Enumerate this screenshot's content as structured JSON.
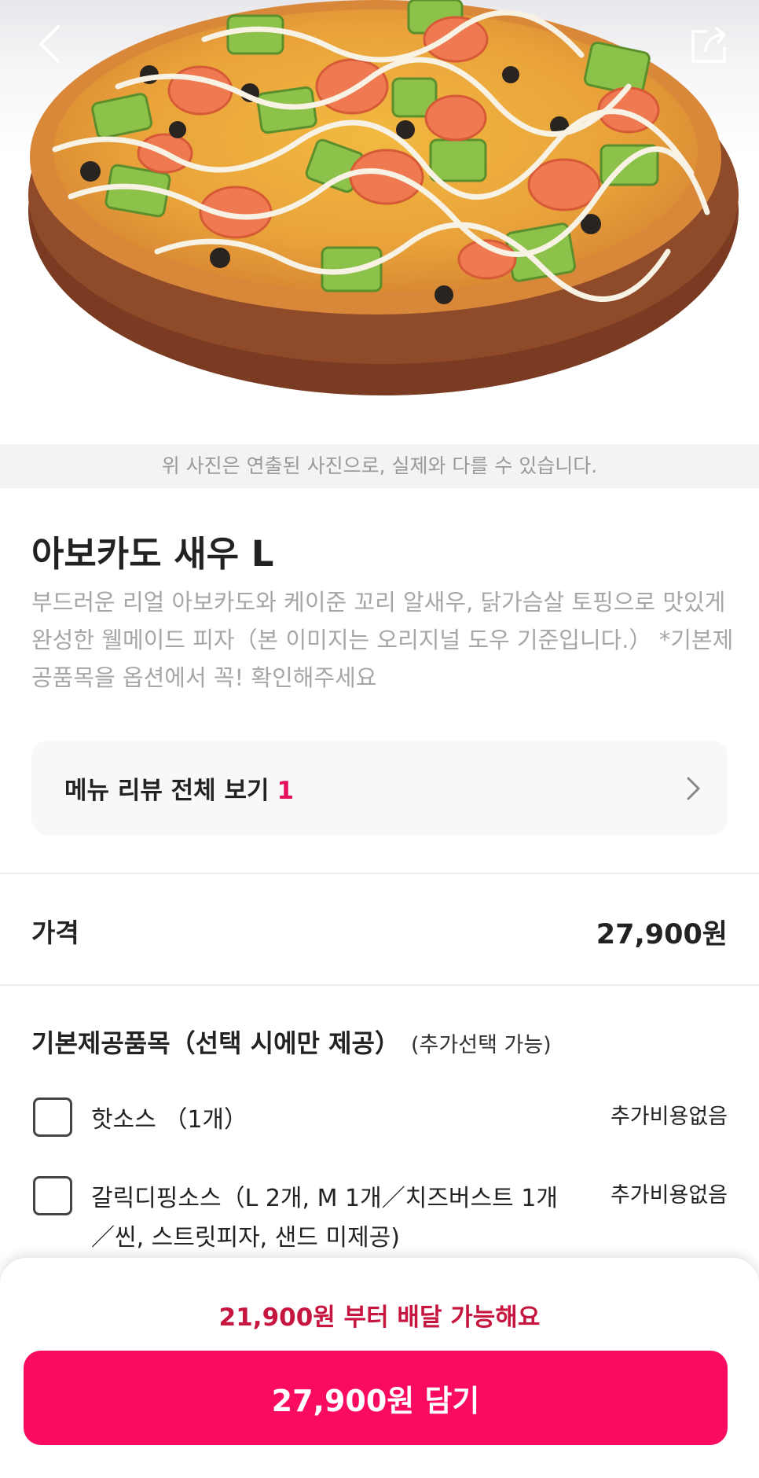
{
  "hero": {
    "image_alt": "Avocado shrimp pizza photo",
    "back_icon": "chevron-left-icon",
    "share_icon": "share-icon"
  },
  "disclaimer": "위 사진은 연출된 사진으로, 실제와 다를 수 있습니다.",
  "product": {
    "name": "아보카도 새우 L",
    "description": "부드러운 리얼 아보카도와 케이준 꼬리 알새우, 닭가슴살 토핑으로 맛있게 완성한 웰메이드 피자（본 이미지는 오리지널 도우 기준입니다.） *기본제공품목을 옵션에서 꼭! 확인해주세요"
  },
  "review": {
    "label": "메뉴 리뷰 전체 보기",
    "count": "1",
    "chevron_icon": "chevron-right-icon"
  },
  "price": {
    "label": "가격",
    "value": "27,900원"
  },
  "options_section": {
    "title": "기본제공품목（선택 시에만 제공）",
    "subtitle": "(추가선택 가능)",
    "items": [
      {
        "label": "핫소스 （1개）",
        "price": "추가비용없음",
        "checked": false
      },
      {
        "label": "갈릭디핑소스（L 2개, M 1개／치즈버스트 1개／씬, 스트릿피자, 샌드 미제공)",
        "price": "추가비용없음",
        "checked": false
      }
    ]
  },
  "footer": {
    "min_order": "21,900원 부터 배달 가능해요",
    "add_button": "27,900원 담기"
  },
  "colors": {
    "accent": "#fa0a61",
    "min_order_text": "#c6153e",
    "review_count": "#e5115f"
  }
}
